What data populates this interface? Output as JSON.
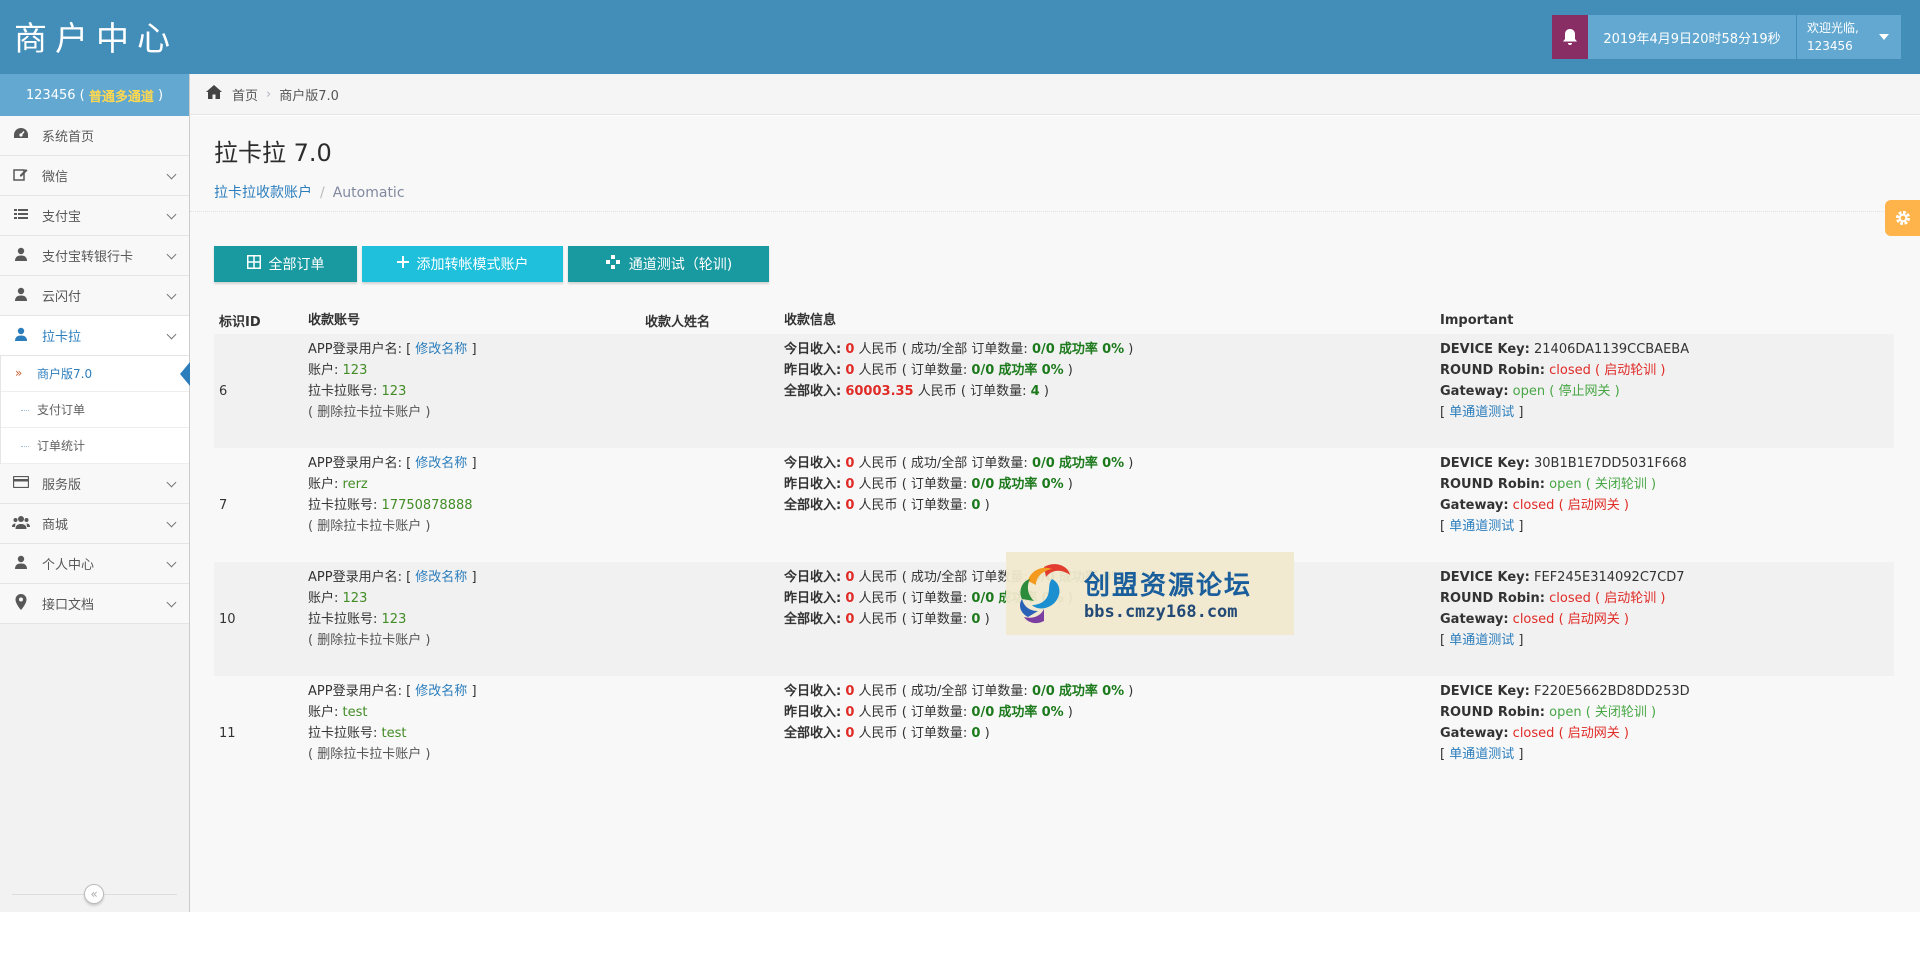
{
  "header": {
    "brand": "商户中心",
    "datetime": "2019年4月9日20时58分19秒",
    "welcome_line1": "欢迎光临,",
    "welcome_line2": "123456"
  },
  "sidebar": {
    "user": "123456 (",
    "user_level": "普通多通道",
    "user_close": ")",
    "items": [
      {
        "label": "系统首页",
        "icon": "dashboard-icon"
      },
      {
        "label": "微信",
        "icon": "edit-icon"
      },
      {
        "label": "支付宝",
        "icon": "list-icon"
      },
      {
        "label": "支付宝转银行卡",
        "icon": "user-icon"
      },
      {
        "label": "云闪付",
        "icon": "user-icon"
      },
      {
        "label": "拉卡拉",
        "icon": "user-icon"
      },
      {
        "label": "服务版",
        "icon": "credit-card-icon"
      },
      {
        "label": "商城",
        "icon": "users-icon"
      },
      {
        "label": "个人中心",
        "icon": "user-icon"
      },
      {
        "label": "接口文档",
        "icon": "map-marker-icon"
      }
    ],
    "sub_items": [
      {
        "label": "商户版7.0"
      },
      {
        "label": "支付订单"
      },
      {
        "label": "订单统计"
      }
    ]
  },
  "breadcrumbs": {
    "home": "首页",
    "current": "商户版7.0"
  },
  "page": {
    "title": "拉卡拉 7.0",
    "sub_link": "拉卡拉收款账户",
    "sub_current": "Automatic"
  },
  "buttons": {
    "all_orders": "全部订单",
    "add_account": "添加转帐模式账户",
    "channel_test": "通道测试（轮训)"
  },
  "table": {
    "headers": {
      "id": "标识ID",
      "account": "收款账号",
      "name": "收款人姓名",
      "info": "收款信息",
      "important": "Important"
    },
    "labels": {
      "app_user": "APP登录用户名: [",
      "rename": "修改名称",
      "bracket_close": "]",
      "account": "账户:",
      "lkl_account": "拉卡拉账号:",
      "delete": "( 删除拉卡拉卡账户 )",
      "today": "今日收入:",
      "yesterday": "昨日收入:",
      "total": "全部收入:",
      "rmb": "人民币",
      "today_mid": "( 成功/全部 订单数量:",
      "order_count": "( 订单数量:",
      "rate": "成功率",
      "close_paren": ")",
      "device_key": "DEVICE Key:",
      "round_robin": "ROUND Robin:",
      "gateway": "Gateway:",
      "single_test": "单通道测试"
    },
    "rows": [
      {
        "id": "6",
        "account": "123",
        "lkl_account": "123",
        "today_income": "0",
        "today_orders": "0/0",
        "today_rate": "0%",
        "yesterday_income": "0",
        "yesterday_orders": "0/0",
        "yesterday_rate": "0%",
        "total_income": "60003.35",
        "total_orders": "4",
        "device_key": "21406DA1139CCBAEBA",
        "round_state": "closed",
        "round_action": "( 启动轮训 )",
        "gateway_state": "open",
        "gateway_action": "( 停止网关 )"
      },
      {
        "id": "7",
        "account": "rerz",
        "lkl_account": "17750878888",
        "today_income": "0",
        "today_orders": "0/0",
        "today_rate": "0%",
        "yesterday_income": "0",
        "yesterday_orders": "0/0",
        "yesterday_rate": "0%",
        "total_income": "0",
        "total_orders": "0",
        "device_key": "30B1B1E7DD5031F668",
        "round_state": "open",
        "round_action": "( 关闭轮训 )",
        "gateway_state": "closed",
        "gateway_action": "( 启动网关 )"
      },
      {
        "id": "10",
        "account": "123",
        "lkl_account": "123",
        "today_income": "0",
        "today_orders": "0/0",
        "today_rate": "0%",
        "yesterday_income": "0",
        "yesterday_orders": "0/0",
        "yesterday_rate": "0%",
        "total_income": "0",
        "total_orders": "0",
        "device_key": "FEF245E314092C7CD7",
        "round_state": "closed",
        "round_action": "( 启动轮训 )",
        "gateway_state": "closed",
        "gateway_action": "( 启动网关 )"
      },
      {
        "id": "11",
        "account": "test",
        "lkl_account": "test",
        "today_income": "0",
        "today_orders": "0/0",
        "today_rate": "0%",
        "yesterday_income": "0",
        "yesterday_orders": "0/0",
        "yesterday_rate": "0%",
        "total_income": "0",
        "total_orders": "0",
        "device_key": "F220E5662BD8DD253D",
        "round_state": "open",
        "round_action": "( 关闭轮训 )",
        "gateway_state": "closed",
        "gateway_action": "( 启动网关 )"
      }
    ]
  },
  "watermark": {
    "cn": "创盟资源论坛",
    "url": "bbs.cmzy168.com"
  },
  "colors": {
    "header": "#438eb9",
    "bell": "#892e65",
    "button_teal": "#199aa1",
    "button_cyan": "#1ec0dc",
    "open": "#48a645",
    "closed": "#e02b27",
    "link": "#2b7dbc",
    "settings": "#ffb44b"
  }
}
